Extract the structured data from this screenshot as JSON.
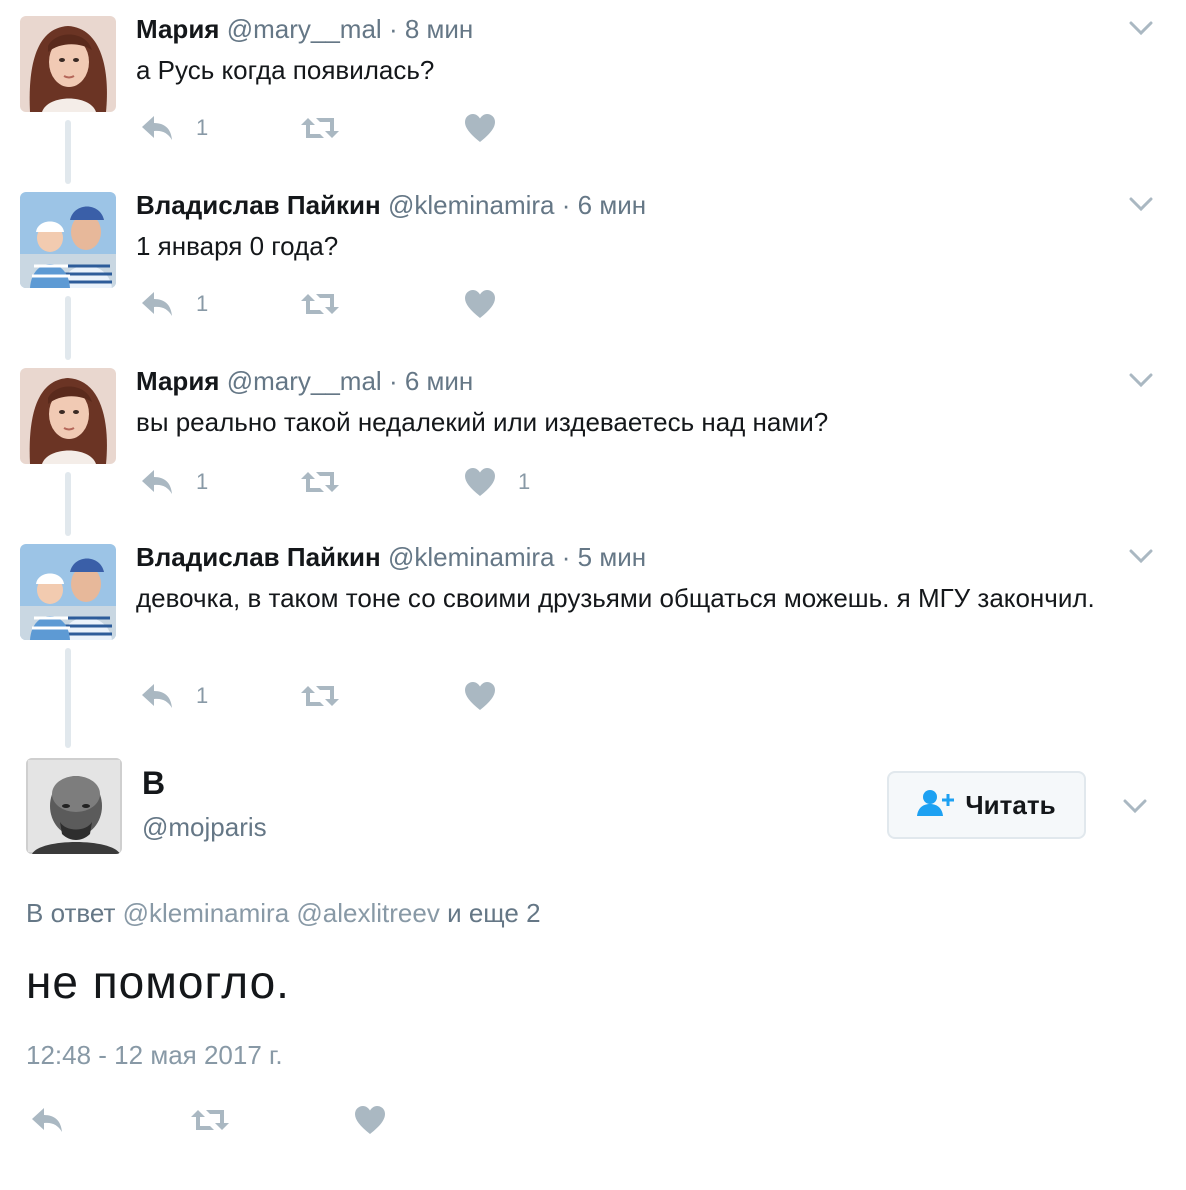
{
  "thread": [
    {
      "name": "Мария",
      "handle": "@mary__mal",
      "dot": "·",
      "time": "8 мин",
      "text": "а Русь когда появилась?",
      "avatar": "woman-avatar",
      "reply_count": "1",
      "retweet_count": "",
      "like_count": ""
    },
    {
      "name": "Владислав Пайкин",
      "handle": "@kleminamira",
      "dot": "·",
      "time": "6 мин",
      "text": "1 января 0 года?",
      "avatar": "man-with-child-avatar",
      "reply_count": "1",
      "retweet_count": "",
      "like_count": ""
    },
    {
      "name": "Мария",
      "handle": "@mary__mal",
      "dot": "·",
      "time": "6 мин",
      "text": "вы реально такой недалекий или издеваетесь над нами?",
      "avatar": "woman-avatar",
      "reply_count": "1",
      "retweet_count": "",
      "like_count": "1"
    },
    {
      "name": "Владислав Пайкин",
      "handle": "@kleminamira",
      "dot": "·",
      "time": "5 мин",
      "text": "девочка, в таком тоне со своими друзьями общаться можешь. я МГУ закончил.",
      "avatar": "man-with-child-avatar",
      "reply_count": "1",
      "retweet_count": "",
      "like_count": ""
    }
  ],
  "main_tweet": {
    "name": "B",
    "handle": "@mojparis",
    "follow_label": "Читать",
    "reply_prefix": "В ответ",
    "reply_mention_1": "@kleminamira",
    "reply_mention_2": "@alexlitreev",
    "reply_suffix": "и еще 2",
    "text": "не помогло.",
    "timestamp": "12:48 - 12 мая 2017 г."
  },
  "colors": {
    "icon_gray": "#aab8c2",
    "text_primary": "#14171a",
    "text_secondary": "#657786",
    "thread_line": "#e1e8ed",
    "follow_icon": "#1da1f2"
  }
}
